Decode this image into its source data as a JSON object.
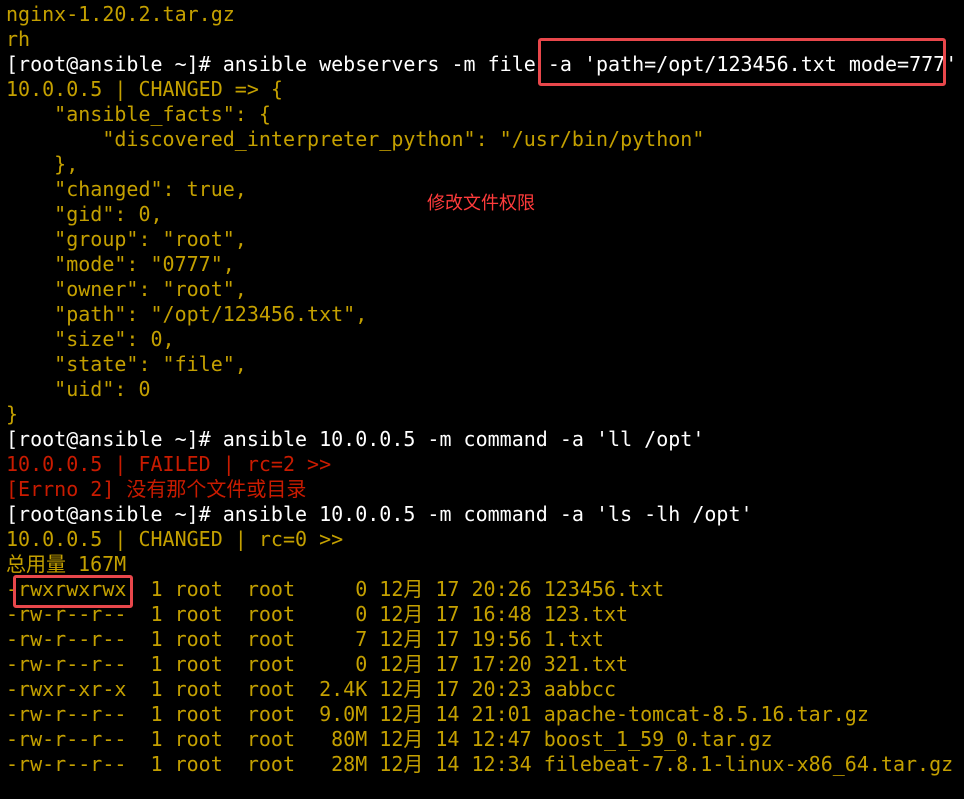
{
  "colors": {
    "background": "#000000",
    "normal_text": "#ffffff",
    "changed_output": "#c4a000",
    "failed_output": "#c91b00",
    "highlight_box": "#e8474b",
    "annotation": "#ff3b3b"
  },
  "terminal": {
    "lines": [
      {
        "color": "yellow",
        "text": "nginx-1.20.2.tar.gz"
      },
      {
        "color": "yellow",
        "text": "rh"
      },
      {
        "color": "white",
        "text": "[root@ansible ~]# ansible webservers -m file -a 'path=/opt/123456.txt mode=777'"
      },
      {
        "color": "yellow",
        "text": "10.0.0.5 | CHANGED => {"
      },
      {
        "color": "yellow",
        "text": "    \"ansible_facts\": {"
      },
      {
        "color": "yellow",
        "text": "        \"discovered_interpreter_python\": \"/usr/bin/python\""
      },
      {
        "color": "yellow",
        "text": "    },"
      },
      {
        "color": "yellow",
        "text": "    \"changed\": true,"
      },
      {
        "color": "yellow",
        "text": "    \"gid\": 0,"
      },
      {
        "color": "yellow",
        "text": "    \"group\": \"root\","
      },
      {
        "color": "yellow",
        "text": "    \"mode\": \"0777\","
      },
      {
        "color": "yellow",
        "text": "    \"owner\": \"root\","
      },
      {
        "color": "yellow",
        "text": "    \"path\": \"/opt/123456.txt\","
      },
      {
        "color": "yellow",
        "text": "    \"size\": 0,"
      },
      {
        "color": "yellow",
        "text": "    \"state\": \"file\","
      },
      {
        "color": "yellow",
        "text": "    \"uid\": 0"
      },
      {
        "color": "yellow",
        "text": "}"
      },
      {
        "color": "white",
        "text": "[root@ansible ~]# ansible 10.0.0.5 -m command -a 'll /opt'"
      },
      {
        "color": "red",
        "text": "10.0.0.5 | FAILED | rc=2 >>"
      },
      {
        "color": "red",
        "text": "[Errno 2] 没有那个文件或目录"
      },
      {
        "color": "white",
        "text": "[root@ansible ~]# ansible 10.0.0.5 -m command -a 'ls -lh /opt'"
      },
      {
        "color": "yellow",
        "text": "10.0.0.5 | CHANGED | rc=0 >>"
      },
      {
        "color": "yellow",
        "text": "总用量 167M"
      },
      {
        "color": "yellow",
        "text": "-rwxrwxrwx  1 root  root     0 12月 17 20:26 123456.txt"
      },
      {
        "color": "yellow",
        "text": "-rw-r--r--  1 root  root     0 12月 17 16:48 123.txt"
      },
      {
        "color": "yellow",
        "text": "-rw-r--r--  1 root  root     7 12月 17 19:56 1.txt"
      },
      {
        "color": "yellow",
        "text": "-rw-r--r--  1 root  root     0 12月 17 17:20 321.txt"
      },
      {
        "color": "yellow",
        "text": "-rwxr-xr-x  1 root  root  2.4K 12月 17 20:23 aabbcc"
      },
      {
        "color": "yellow",
        "text": "-rw-r--r--  1 root  root  9.0M 12月 14 21:01 apache-tomcat-8.5.16.tar.gz"
      },
      {
        "color": "yellow",
        "text": "-rw-r--r--  1 root  root   80M 12月 14 12:47 boost_1_59_0.tar.gz"
      },
      {
        "color": "yellow",
        "text": "-rw-r--r--  1 root  root   28M 12月 14 12:34 filebeat-7.8.1-linux-x86_64.tar.gz"
      }
    ]
  },
  "annotation": {
    "text": "修改文件权限"
  }
}
